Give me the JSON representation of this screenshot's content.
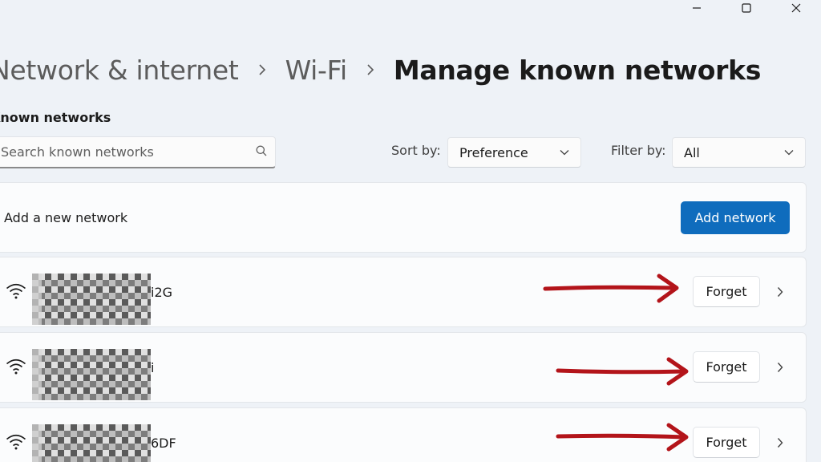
{
  "breadcrumb": {
    "items": [
      {
        "label": "Network & internet"
      },
      {
        "label": "Wi-Fi"
      },
      {
        "label": "Manage known networks"
      }
    ]
  },
  "known_networks": {
    "heading": "Known networks",
    "search_placeholder": "Search known networks",
    "sort_label": "Sort by:",
    "sort_value": "Preference",
    "filter_label": "Filter by:",
    "filter_value": "All"
  },
  "add_network": {
    "label": "Add a new network",
    "button_label": "Add network"
  },
  "networks": [
    {
      "ssid_visible_suffix": "i2G",
      "forget_label": "Forget"
    },
    {
      "ssid_visible_suffix": "i",
      "forget_label": "Forget"
    },
    {
      "ssid_visible_suffix": "6DF",
      "forget_label": "Forget"
    }
  ],
  "colors": {
    "accent": "#0f6cbd",
    "annotation_arrow": "#b3141a",
    "background": "#eef2f7"
  },
  "icons": [
    "minimize-icon",
    "maximize-icon",
    "close-icon",
    "chevron-right-icon",
    "search-icon",
    "chevron-down-icon",
    "wifi-icon"
  ]
}
